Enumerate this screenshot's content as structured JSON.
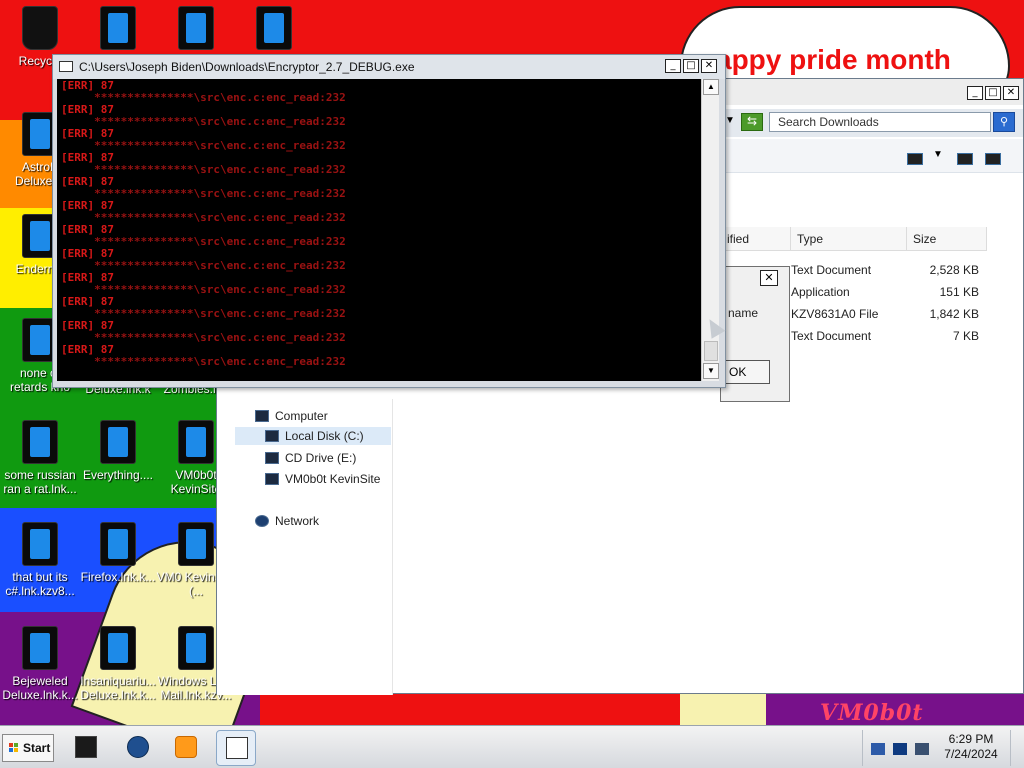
{
  "wallpaper": {
    "banner_text": "appy pride month",
    "graffiti_text": "VM0b0t"
  },
  "desktop_icons": [
    {
      "label": "Recycle"
    },
    {
      "label": ""
    },
    {
      "label": ""
    },
    {
      "label": ""
    },
    {
      "label": "AstroP Deluxe.in"
    },
    {
      "label": "Enderma"
    },
    {
      "label": "none of retards kno"
    },
    {
      "label": "Deluxe.lnk.k"
    },
    {
      "label": "Zombies.lnk"
    },
    {
      "label": "some russian ran a rat.lnk..."
    },
    {
      "label": "Everything...."
    },
    {
      "label": "VM0b0t KevinSite"
    },
    {
      "label": "that but its c#.lnk.kzv8..."
    },
    {
      "label": "Firefox.lnk.k..."
    },
    {
      "label": "VM0 KevinSite (..."
    },
    {
      "label": "Bejeweled Deluxe.lnk.k..."
    },
    {
      "label": "Insaniquariu... Deluxe.lnk.k..."
    },
    {
      "label": "Windows Liv... Mail.lnk.kzv..."
    }
  ],
  "console": {
    "title": "C:\\Users\\Joseph Biden\\Downloads\\Encryptor_2.7_DEBUG.exe",
    "error_tag": "[ERR] 87",
    "path_line": "     ***************\\src\\enc.c:enc_read:232",
    "repeat_count": 12,
    "controls": {
      "minimize": "_",
      "maximize": "□",
      "close": "✕"
    }
  },
  "explorer": {
    "search_placeholder": "Search Downloads",
    "columns": {
      "modified": "ified",
      "type": "Type",
      "size": "Size"
    },
    "files": [
      {
        "type": "Text Document",
        "size": "2,528 KB"
      },
      {
        "type": "Application",
        "size": "151 KB"
      },
      {
        "type": "KZV8631A0 File",
        "size": "1,842 KB"
      },
      {
        "type": "Text Document",
        "size": "7 KB"
      }
    ],
    "nav": {
      "computer": "Computer",
      "local_disk": "Local Disk (C:)",
      "cd_drive": "CD Drive (E:)",
      "vm_site": "VM0b0t KevinSite",
      "network": "Network"
    },
    "controls": {
      "minimize": "_",
      "maximize": "□",
      "close": "✕"
    }
  },
  "dialog": {
    "close": "✕",
    "name_label": "name",
    "ok_label": "OK"
  },
  "taskbar": {
    "start_label": "Start",
    "clock_time": "6:29 PM",
    "clock_date": "7/24/2024"
  }
}
